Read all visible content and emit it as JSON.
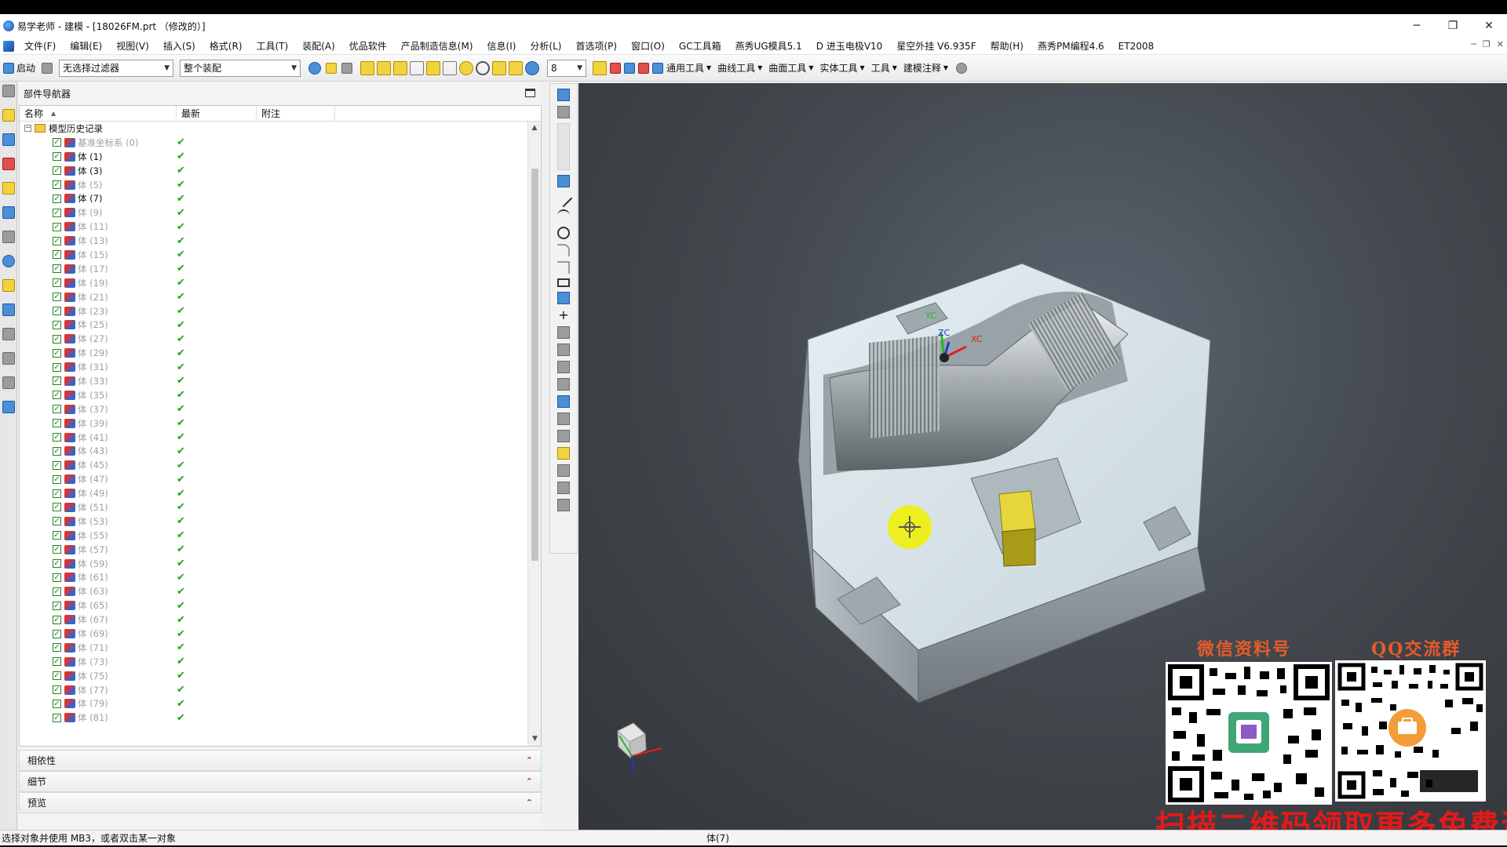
{
  "window": {
    "title": "易学老师 - 建模 - [18026FM.prt （修改的）]",
    "controls": [
      "─",
      "❐",
      "✕"
    ]
  },
  "menu": {
    "items": [
      "文件(F)",
      "编辑(E)",
      "视图(V)",
      "插入(S)",
      "格式(R)",
      "工具(T)",
      "装配(A)",
      "优品软件",
      "产品制造信息(M)",
      "信息(I)",
      "分析(L)",
      "首选项(P)",
      "窗口(O)",
      "GC工具箱",
      "燕秀UG模具5.1",
      "D 进玉电极V10",
      "星空外挂 V6.935F",
      "帮助(H)",
      "燕秀PM编程4.6",
      "ET2008"
    ]
  },
  "toolbar": {
    "start_label": "启动",
    "filter_value": "无选择过滤器",
    "assembly_value": "整个装配",
    "layer_value": "8",
    "groups": [
      "通用工具",
      "曲线工具",
      "曲面工具",
      "实体工具",
      "工具",
      "建模注释"
    ]
  },
  "navigator": {
    "title": "部件导航器",
    "columns": [
      "名称",
      "最新",
      "附注"
    ],
    "root_label": "模型历史记录",
    "root_expander": "−",
    "latest_mark": "✔",
    "items": [
      {
        "label": "基准坐标系 (0)",
        "dim": true
      },
      {
        "label": "体 (1)",
        "dim": false
      },
      {
        "label": "体 (3)",
        "dim": false
      },
      {
        "label": "体 (5)",
        "dim": true
      },
      {
        "label": "体 (7)",
        "dim": false
      },
      {
        "label": "体 (9)",
        "dim": true
      },
      {
        "label": "体 (11)",
        "dim": true
      },
      {
        "label": "体 (13)",
        "dim": true
      },
      {
        "label": "体 (15)",
        "dim": true
      },
      {
        "label": "体 (17)",
        "dim": true
      },
      {
        "label": "体 (19)",
        "dim": true
      },
      {
        "label": "体 (21)",
        "dim": true
      },
      {
        "label": "体 (23)",
        "dim": true
      },
      {
        "label": "体 (25)",
        "dim": true
      },
      {
        "label": "体 (27)",
        "dim": true
      },
      {
        "label": "体 (29)",
        "dim": true
      },
      {
        "label": "体 (31)",
        "dim": true
      },
      {
        "label": "体 (33)",
        "dim": true
      },
      {
        "label": "体 (35)",
        "dim": true
      },
      {
        "label": "体 (37)",
        "dim": true
      },
      {
        "label": "体 (39)",
        "dim": true
      },
      {
        "label": "体 (41)",
        "dim": true
      },
      {
        "label": "体 (43)",
        "dim": true
      },
      {
        "label": "体 (45)",
        "dim": true
      },
      {
        "label": "体 (47)",
        "dim": true
      },
      {
        "label": "体 (49)",
        "dim": true
      },
      {
        "label": "体 (51)",
        "dim": true
      },
      {
        "label": "体 (53)",
        "dim": true
      },
      {
        "label": "体 (55)",
        "dim": true
      },
      {
        "label": "体 (57)",
        "dim": true
      },
      {
        "label": "体 (59)",
        "dim": true
      },
      {
        "label": "体 (61)",
        "dim": true
      },
      {
        "label": "体 (63)",
        "dim": true
      },
      {
        "label": "体 (65)",
        "dim": true
      },
      {
        "label": "体 (67)",
        "dim": true
      },
      {
        "label": "体 (69)",
        "dim": true
      },
      {
        "label": "体 (71)",
        "dim": true
      },
      {
        "label": "体 (73)",
        "dim": true
      },
      {
        "label": "体 (75)",
        "dim": true
      },
      {
        "label": "体 (77)",
        "dim": true
      },
      {
        "label": "体 (79)",
        "dim": true
      },
      {
        "label": "体 (81)",
        "dim": true
      }
    ],
    "sections": [
      "相依性",
      "细节",
      "预览"
    ]
  },
  "viewport": {
    "csys_labels": [
      "YC",
      "ZC",
      "XC"
    ],
    "background_color": "#44494f",
    "part_color": "#c9d3d8",
    "electrode_color": "#e6d63c"
  },
  "watermark": {
    "wechat_title": "微信资料号",
    "qq_title": "QQ交流群",
    "promo_text": "扫描二维码领取更多免费资料"
  },
  "status": {
    "message": "选择对象并使用 MB3，或者双击某一对象",
    "selection": "体(7)"
  }
}
